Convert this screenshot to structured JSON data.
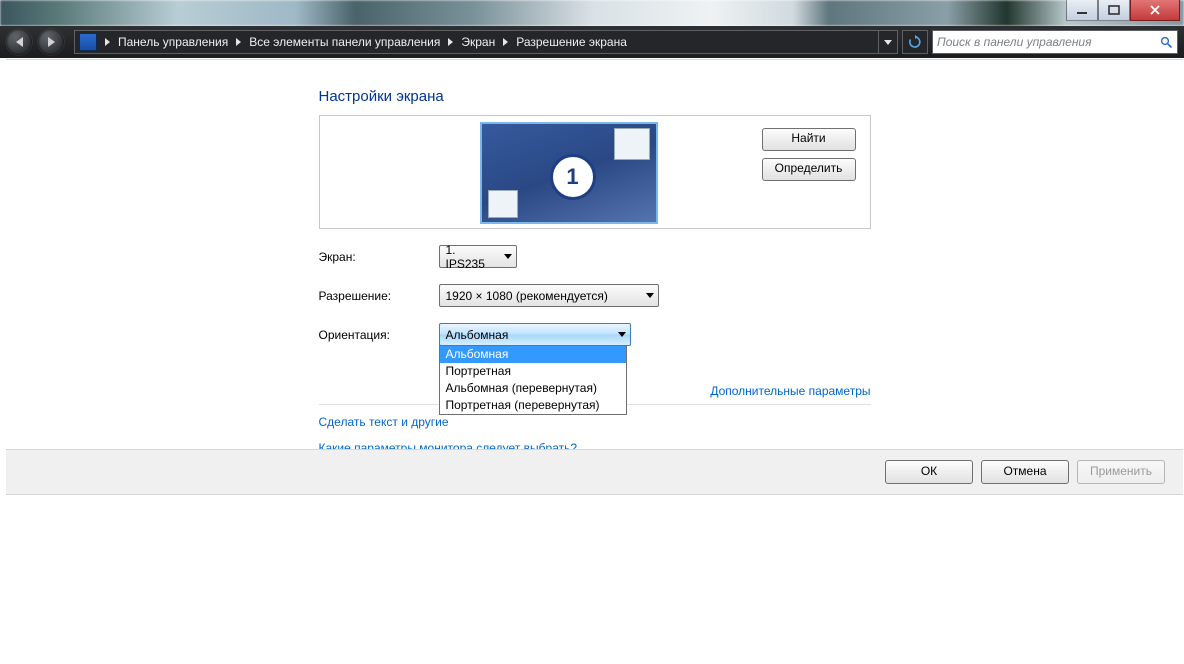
{
  "search": {
    "placeholder": "Поиск в панели управления"
  },
  "breadcrumb": [
    "Панель управления",
    "Все элементы панели управления",
    "Экран",
    "Разрешение экрана"
  ],
  "page": {
    "title": "Настройки экрана",
    "monitor_number": "1",
    "find_button": "Найти",
    "detect_button": "Определить"
  },
  "labels": {
    "screen": "Экран:",
    "resolution": "Разрешение:",
    "orientation": "Ориентация:"
  },
  "values": {
    "screen": "1. IPS235",
    "resolution": "1920 × 1080 (рекомендуется)",
    "orientation": "Альбомная"
  },
  "orientation_options": [
    "Альбомная",
    "Портретная",
    "Альбомная (перевернутая)",
    "Портретная (перевернутая)"
  ],
  "links": {
    "advanced": "Дополнительные параметры",
    "text_size": "Сделать текст и другие",
    "monitor_help": "Какие параметры монитора следует выбрать?"
  },
  "buttons": {
    "ok": "ОК",
    "cancel": "Отмена",
    "apply": "Применить"
  }
}
